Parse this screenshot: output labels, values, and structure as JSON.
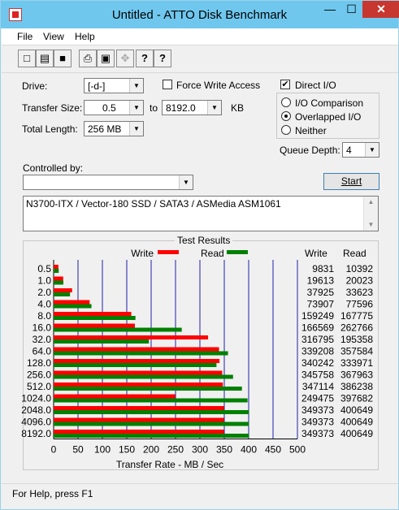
{
  "window": {
    "title": "Untitled - ATTO Disk Benchmark",
    "minimize_glyph": "—",
    "maximize_glyph": "☐",
    "close_glyph": "✕"
  },
  "menu": {
    "file": "File",
    "view": "View",
    "help": "Help"
  },
  "toolbar": {
    "icons": [
      "new-doc-icon",
      "open-folder-icon",
      "save-icon",
      "print-icon",
      "print-preview-icon",
      "move-icon",
      "help-icon",
      "context-help-icon"
    ],
    "glyphs": {
      "new": "□",
      "open": "▤",
      "save": "■",
      "print": "⎙",
      "preview": "▣",
      "move": "✥",
      "help": "?",
      "context_help": "?"
    }
  },
  "settings": {
    "drive_label": "Drive:",
    "drive_value": "[-d-]",
    "force_write_label": "Force Write Access",
    "force_write_checked": false,
    "direct_io_label": "Direct I/O",
    "direct_io_checked": true,
    "check_glyph": "✔",
    "transfer_size_label": "Transfer Size:",
    "transfer_from": "0.5",
    "to_label": "to",
    "transfer_to": "8192.0",
    "kb_label": "KB",
    "total_length_label": "Total Length:",
    "total_length_value": "256 MB",
    "io_comparison_label": "I/O Comparison",
    "overlapped_io_label": "Overlapped I/O",
    "neither_label": "Neither",
    "selected_io_mode": "Overlapped I/O",
    "queue_depth_label": "Queue Depth:",
    "queue_depth_value": "4",
    "controlled_by_label": "Controlled by:",
    "controlled_by_value": "",
    "start_label": "Start",
    "arrow_glyph": "▼"
  },
  "description": "N3700-ITX / Vector-180 SSD / SATA3 / ASMedia ASM1061",
  "scroll": {
    "up": "▲",
    "down": "▼"
  },
  "results": {
    "title": "Test Results",
    "write_col": "Write",
    "read_col": "Read"
  },
  "chart_data": {
    "type": "bar",
    "orientation": "horizontal",
    "title": "Test Results",
    "xlabel": "Transfer Rate - MB / Sec",
    "xlim": [
      0,
      500
    ],
    "xticks": [
      "0",
      "50",
      "100",
      "150",
      "200",
      "250",
      "300",
      "350",
      "400",
      "450",
      "500"
    ],
    "grid": true,
    "legend": "top-center",
    "categories": [
      "0.5",
      "1.0",
      "2.0",
      "4.0",
      "8.0",
      "16.0",
      "32.0",
      "64.0",
      "128.0",
      "256.0",
      "512.0",
      "1024.0",
      "2048.0",
      "4096.0",
      "8192.0"
    ],
    "series": [
      {
        "name": "Write",
        "color": "#ff0000",
        "values": [
          9.8,
          19.6,
          37.9,
          73.9,
          159.2,
          166.6,
          316.8,
          339.2,
          340.2,
          345.8,
          347.1,
          249.5,
          349.4,
          349.4,
          349.4
        ],
        "labels": [
          "9831",
          "19613",
          "37925",
          "73907",
          "159249",
          "166569",
          "316795",
          "339208",
          "340242",
          "345758",
          "347114",
          "249475",
          "349373",
          "349373",
          "349373"
        ]
      },
      {
        "name": "Read",
        "color": "#008000",
        "values": [
          10.4,
          20.0,
          33.6,
          77.6,
          167.8,
          262.8,
          195.4,
          357.6,
          334.0,
          368.0,
          386.2,
          397.7,
          400.6,
          400.6,
          400.6
        ],
        "labels": [
          "10392",
          "20023",
          "33623",
          "77596",
          "167775",
          "262766",
          "195358",
          "357584",
          "333971",
          "367963",
          "386238",
          "397682",
          "400649",
          "400649",
          "400649"
        ]
      }
    ]
  },
  "status": {
    "text": "For Help, press F1"
  }
}
